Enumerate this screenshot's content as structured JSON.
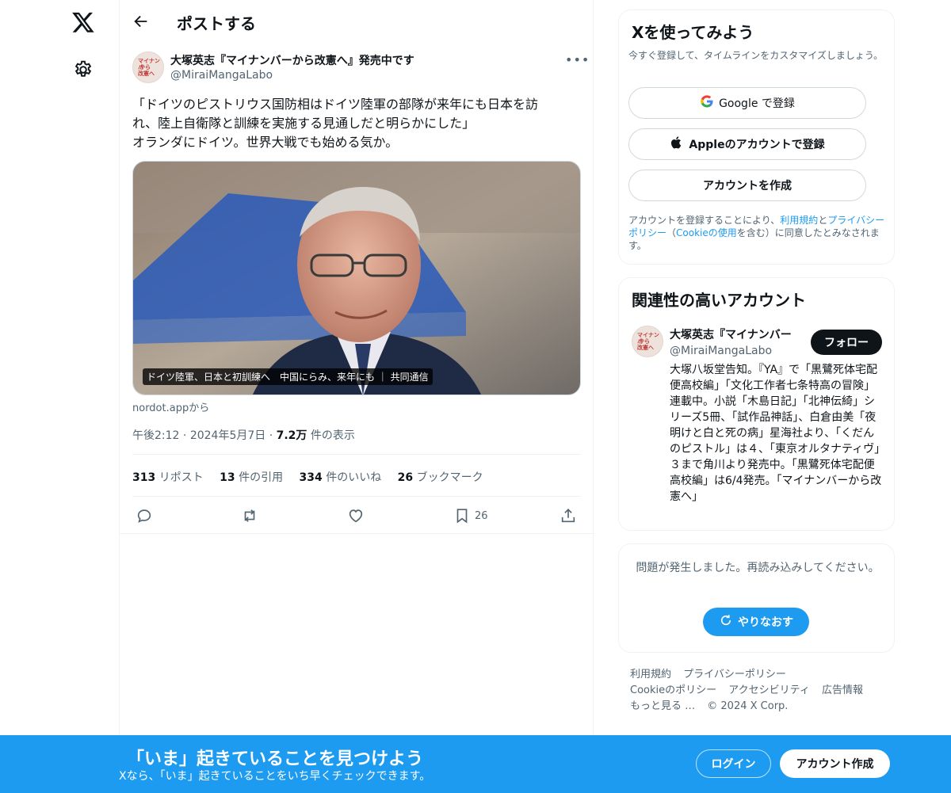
{
  "header": {
    "title": "ポストする"
  },
  "post": {
    "author_name": "大塚英志『マイナンバーから改憲へ』発売中です",
    "handle": "@MiraiMangaLabo",
    "text_lines": [
      "「ドイツのピストリウス国防相はドイツ陸軍の部隊が来年にも日本を訪",
      "れ、陸上自衛隊と訓練を実施する見通しだと明らかにした」",
      "オランダにドイツ。世界大戦でも始める気か。"
    ],
    "media_caption": "ドイツ陸軍、日本と初訓練へ　中国にらみ、来年にも ｜ 共同通信",
    "source": "nordot.appから",
    "time": "午後2:12",
    "date": "2024年5月7日",
    "views_count": "7.2万",
    "views_label": "件の表示",
    "stats": [
      {
        "count": "313",
        "label": "リポスト"
      },
      {
        "count": "13",
        "label": "件の引用"
      },
      {
        "count": "334",
        "label": "件のいいね"
      },
      {
        "count": "26",
        "label": "ブックマーク"
      }
    ],
    "bookmark_count": "26"
  },
  "signup_card": {
    "title": "Xを使ってみよう",
    "subtitle": "今すぐ登録して、タイムラインをカスタマイズしましょう。",
    "google_label": "Google で登録",
    "apple_label": "Appleのアカウントで登録",
    "create_label": "アカウントを作成",
    "legal_prefix": "アカウントを登録することにより、",
    "terms": "利用規約",
    "and": "と",
    "privacy": "プライバシーポリシー",
    "cookie_open": "（",
    "cookie": "Cookieの使用",
    "legal_suffix": "を含む）に同意したとみなされます。"
  },
  "related": {
    "title": "関連性の高いアカウント",
    "name": "大塚英志『マイナンバー",
    "handle": "@MiraiMangaLabo",
    "follow_label": "フォロー",
    "bio": "大塚八坂堂告知。『YA』で「黒鷺死体宅配便高校編」「文化工作者七条特高の冒険」連載中。小説「木島日記」「北神伝綺」シリーズ5冊、「試作品神話」、白倉由美「夜明けと白と死の病」星海社より、「くだんのピストル」は４、「東京オルタナティヴ」３まで角川より発売中。「黒鷺死体宅配便高校編」は6/4発売。「マイナンバーから改憲へ」"
  },
  "error_card": {
    "message": "問題が発生しました。再読み込みしてください。",
    "retry_label": "やりなおす"
  },
  "footer": {
    "links": [
      "利用規約",
      "プライバシーポリシー",
      "Cookieのポリシー",
      "アクセシビリティ",
      "広告情報",
      "もっと見る …"
    ],
    "copyright": "© 2024 X Corp."
  },
  "banner": {
    "title": "「いま」起きていることを見つけよう",
    "subtitle": "Xなら、「いま」起きていることをいち早くチェックできます。",
    "login_label": "ログイン",
    "signup_label": "アカウント作成"
  },
  "avatar_text": [
    "マイナンバ",
    "から",
    "改憲へ"
  ],
  "colors": {
    "accent": "#1d9bf0",
    "text": "#0f1419",
    "secondary": "#536471"
  }
}
